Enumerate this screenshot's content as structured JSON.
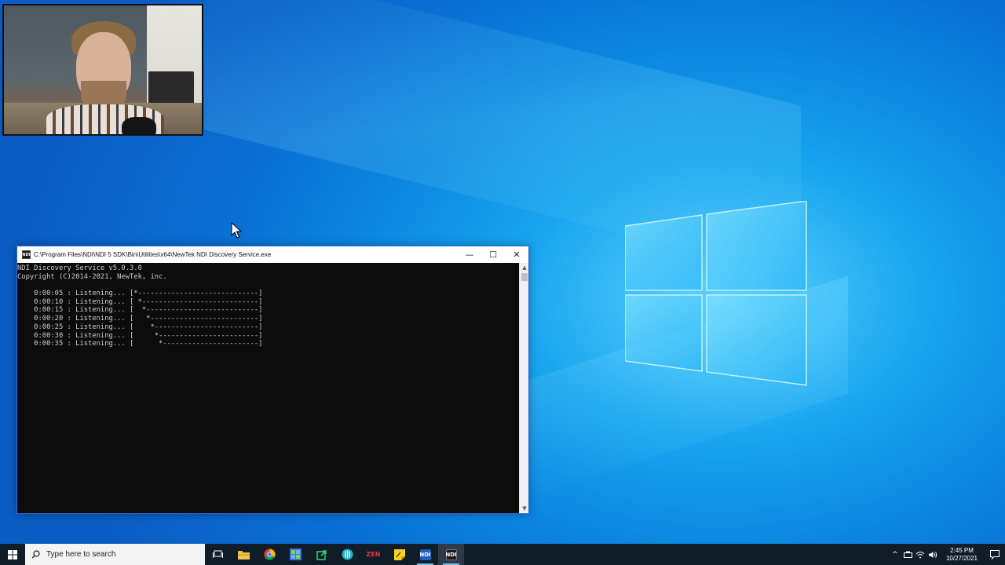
{
  "console": {
    "title": "C:\\Program Files\\NDI\\NDI 5 SDK\\Bin\\Utilities\\x64\\NewTek NDI Discovery Service.exe",
    "app_icon_label": "NDI",
    "minimize_glyph": "—",
    "maximize_glyph": "☐",
    "close_glyph": "✕",
    "lines": [
      "NDI Discovery Service v5.0.3.0",
      "Copyright (C)2014-2021, NewTek, inc.",
      "",
      "    0:00:05 : Listening... [*-----------------------------]",
      "    0:00:10 : Listening... [ *----------------------------]",
      "    0:00:15 : Listening... [  *---------------------------]",
      "    0:00:20 : Listening... [   *--------------------------]",
      "    0:00:25 : Listening... [    *-------------------------]",
      "    0:00:30 : Listening... [     *------------------------]",
      "    0:00:35 : Listening... [      *-----------------------]"
    ]
  },
  "taskbar": {
    "search_placeholder": "Type here to search",
    "apps": [
      {
        "name": "task-view-icon",
        "label": ""
      },
      {
        "name": "file-explorer-icon",
        "label": ""
      },
      {
        "name": "chrome-icon",
        "label": ""
      },
      {
        "name": "app-grid-icon",
        "label": ""
      },
      {
        "name": "green-app-icon",
        "label": ""
      },
      {
        "name": "teal-app-icon",
        "label": ""
      },
      {
        "name": "red-app-icon",
        "label": "ZEN"
      },
      {
        "name": "sticky-notes-icon",
        "label": ""
      },
      {
        "name": "ndi-app-icon",
        "label": "NDI"
      },
      {
        "name": "ndi-console-icon",
        "label": "NDI"
      }
    ],
    "clock_time": "2:45 PM",
    "clock_date": "10/27/2021"
  },
  "colors": {
    "accent": "#76b9ed",
    "console_bg": "#0c0c0c",
    "console_text": "#cccccc",
    "taskbar_bg": "#101c28"
  }
}
